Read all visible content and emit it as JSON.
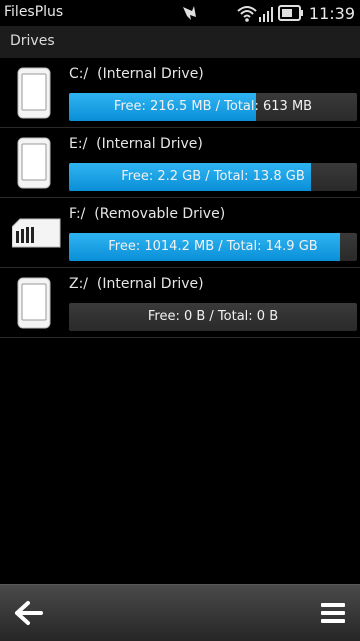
{
  "statusbar": {
    "app_title": "FilesPlus",
    "time": "11:39",
    "icons": [
      "notification-icon",
      "wifi-icon",
      "signal-icon",
      "battery-icon"
    ]
  },
  "header": {
    "title": "Drives"
  },
  "drives": [
    {
      "name": "C:/  (Internal Drive)",
      "usage": "Free: 216.5 MB / Total: 613 MB",
      "icon": "phone-drive-icon",
      "used_fraction": 0.65
    },
    {
      "name": "E:/  (Internal Drive)",
      "usage": "Free: 2.2 GB / Total: 13.8 GB",
      "icon": "phone-drive-icon",
      "used_fraction": 0.84
    },
    {
      "name": "F:/  (Removable Drive)",
      "usage": "Free: 1014.2 MB / Total: 14.9 GB",
      "icon": "memory-card-icon",
      "used_fraction": 0.94
    },
    {
      "name": "Z:/  (Internal Drive)",
      "usage": "Free: 0 B / Total: 0 B",
      "icon": "phone-drive-icon",
      "used_fraction": 0
    }
  ],
  "toolbar": {
    "back_icon": "back-arrow-icon",
    "menu_icon": "menu-icon"
  },
  "colors": {
    "bar_fill": "#1a9fe3",
    "bar_track": "#333333",
    "toolbar": "#3a3a3a"
  }
}
